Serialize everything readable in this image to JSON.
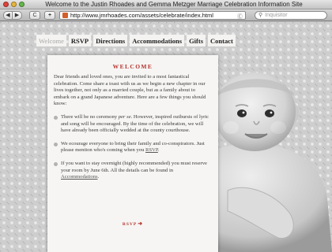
{
  "window": {
    "title": "Welcome to the Justin Rhoades and Gemma Metzger Marriage Celebration Information Site"
  },
  "toolbar": {
    "back_label": "◀",
    "forward_label": "▶",
    "reload_label": "C",
    "add_label": "+",
    "url": "http://www.jmrhoades.com/assets/celebrate/index.html",
    "reader_label": "Ⓒ",
    "search_placeholder": "Inquisitor"
  },
  "nav": {
    "items": [
      {
        "label": "Welcome",
        "active": true
      },
      {
        "label": "RSVP"
      },
      {
        "label": "Directions"
      },
      {
        "label": "Accommodations"
      },
      {
        "label": "Gifts"
      },
      {
        "label": "Contact"
      }
    ]
  },
  "welcome": {
    "title": "WELCOME",
    "intro": "Dear friends and loved ones, you are invited to a most fantastical celebration. Come share a toast with us as we begin a new chapter in our lives together, not only as a married couple, but as a family about to embark on a grand Japanese adventure. Here are a few things you should know:",
    "b1_pre": "There will be no ceremony ",
    "b1_em": "per se",
    "b1_post": ". However, inspired outbursts of lyric and song will be encouraged. By the time of the celebration, we will have already been officially wedded at the county courthouse.",
    "b2_pre": "We ecourage everyone to bring their family and co-conspirators. Just please mention who's coming when you ",
    "b2_link": "RSVP",
    "b2_post": ".",
    "b3_pre": "If you want to stay overnight (highly recommended) you must reserve your room by June 6th. All the details can be found in ",
    "b3_link": "Accommodations",
    "b3_post": ".",
    "rsvp_label": "RSVP"
  }
}
